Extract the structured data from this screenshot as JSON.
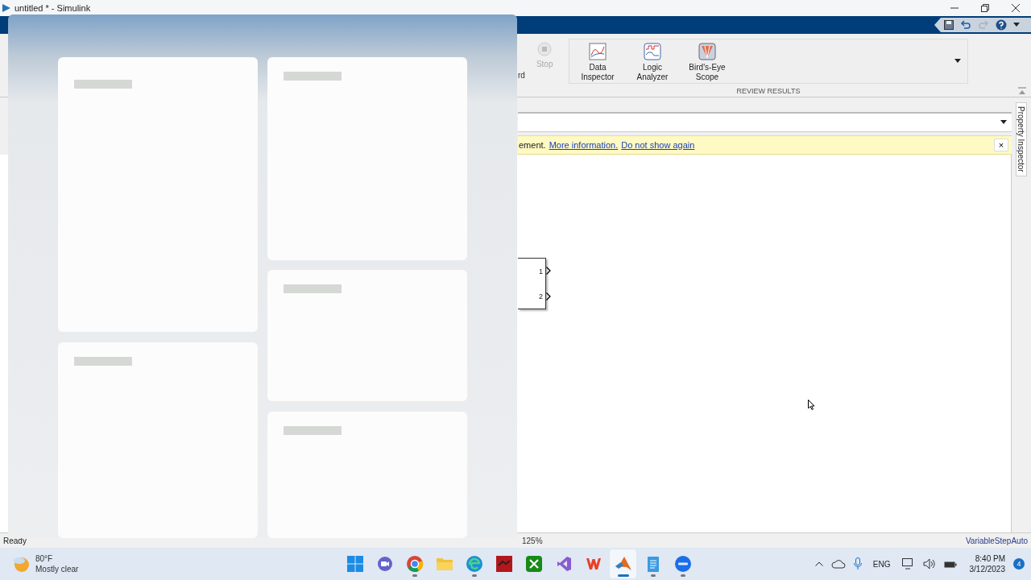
{
  "window": {
    "title": "untitled * - Simulink"
  },
  "ribbon": {
    "partial_label": "rd",
    "stop_button": {
      "label": "Stop",
      "disabled": true
    },
    "review_results": {
      "title": "REVIEW RESULTS",
      "buttons": [
        {
          "label": "Data Inspector",
          "kind": "inspector"
        },
        {
          "label": "Logic Analyzer",
          "kind": "logic"
        },
        {
          "label": "Bird's-Eye Scope",
          "kind": "birdseye"
        }
      ]
    }
  },
  "info_bar": {
    "text": "ement.",
    "links": [
      "More information.",
      "Do not show again"
    ],
    "close": "×"
  },
  "side_panel": {
    "label": "Property Inspector"
  },
  "canvas": {
    "block": {
      "ports": [
        "1",
        "2"
      ]
    }
  },
  "status_bar": {
    "status": "Ready",
    "zoom": "125%",
    "solver": "VariableStepAuto"
  },
  "taskbar": {
    "weather": {
      "temp": "80°F",
      "condition": "Mostly clear"
    },
    "apps": [
      {
        "kind": "start",
        "running": false,
        "active": false
      },
      {
        "kind": "chat",
        "running": false,
        "active": false
      },
      {
        "kind": "chrome",
        "running": true,
        "active": false
      },
      {
        "kind": "folder",
        "running": false,
        "active": false
      },
      {
        "kind": "edge",
        "running": true,
        "active": false
      },
      {
        "kind": "red",
        "running": false,
        "active": false
      },
      {
        "kind": "xbox",
        "running": false,
        "active": false
      },
      {
        "kind": "studio",
        "running": false,
        "active": false
      },
      {
        "kind": "office",
        "running": false,
        "active": false
      },
      {
        "kind": "matlab",
        "running": true,
        "active": true
      },
      {
        "kind": "notepad",
        "running": true,
        "active": false
      },
      {
        "kind": "zoom",
        "running": true,
        "active": false
      }
    ],
    "tray": {
      "language": "ENG",
      "time": "8:40 PM",
      "date": "3/12/2023",
      "notifications": "4"
    }
  }
}
